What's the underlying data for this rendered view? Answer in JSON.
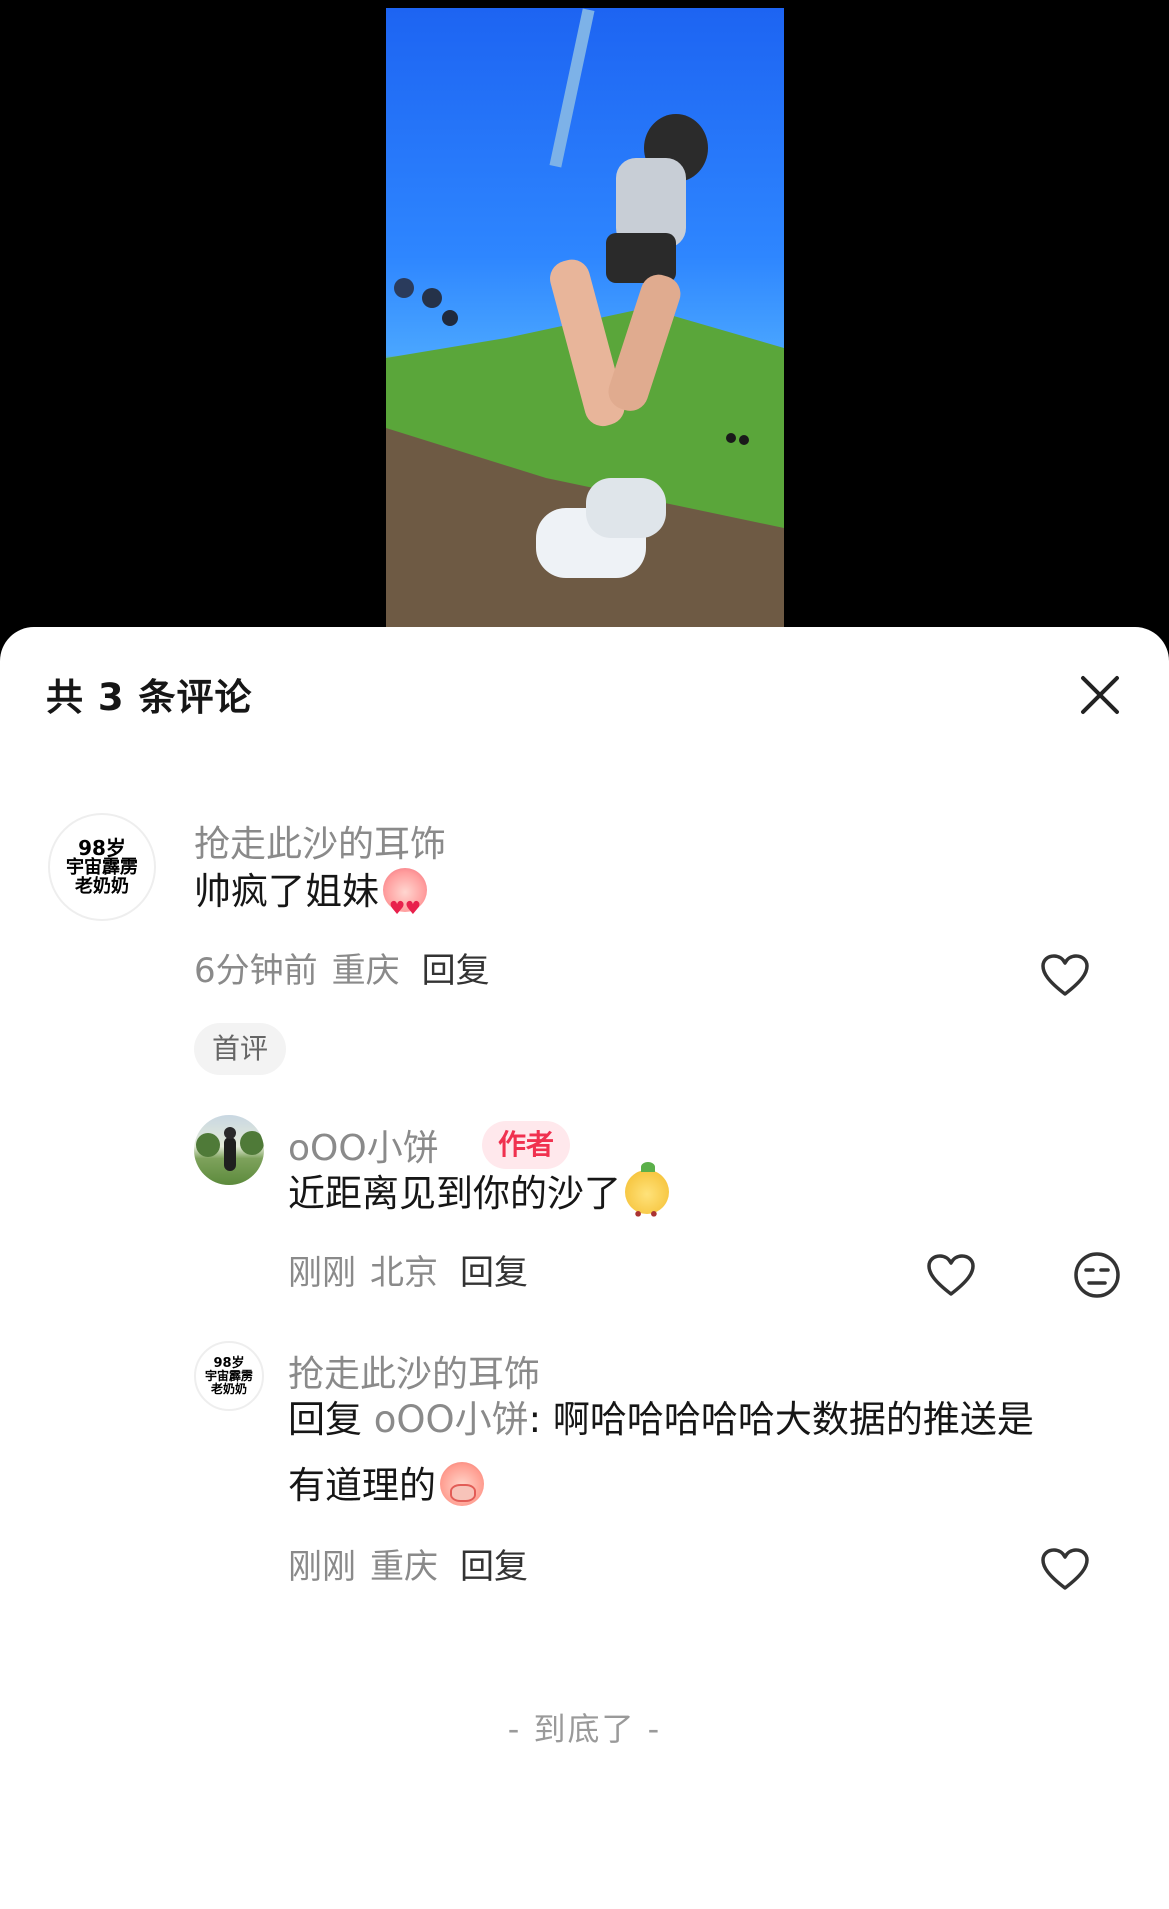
{
  "comments_panel": {
    "title": "共 3 条评论",
    "end_text": "- 到底了 -"
  },
  "comments": [
    {
      "avatar_text": [
        "98岁",
        "宇宙霹雳",
        "老奶奶"
      ],
      "username": "抢走此沙的耳饰",
      "text": "帅疯了姐妹",
      "emoji": "heart-eyes-emoji",
      "time": "6分钟前",
      "location": "重庆",
      "reply_label": "回复",
      "badge": "首评"
    },
    {
      "username": "oOO小饼",
      "author_tag": "作者",
      "text": "近距离见到你的沙了",
      "emoji": "yellow-dog-emoji",
      "time": "刚刚",
      "location": "北京",
      "reply_label": "回复"
    },
    {
      "avatar_text": [
        "98岁",
        "宇宙霹雳",
        "老奶奶"
      ],
      "username": "抢走此沙的耳饰",
      "reply_prefix": "回复",
      "reply_to": "oOO小饼",
      "text_line1": ": 啊哈哈哈哈哈大数据的推送是",
      "text_line2": "有道理的",
      "emoji": "cover-mouth-emoji",
      "time": "刚刚",
      "location": "重庆",
      "reply_label": "回复"
    }
  ],
  "colors": {
    "author_tag_text": "#f0314f",
    "author_tag_bg": "#ffe8ec",
    "muted_text": "#8a8a8a",
    "sky_blue": "#2e86ff"
  }
}
